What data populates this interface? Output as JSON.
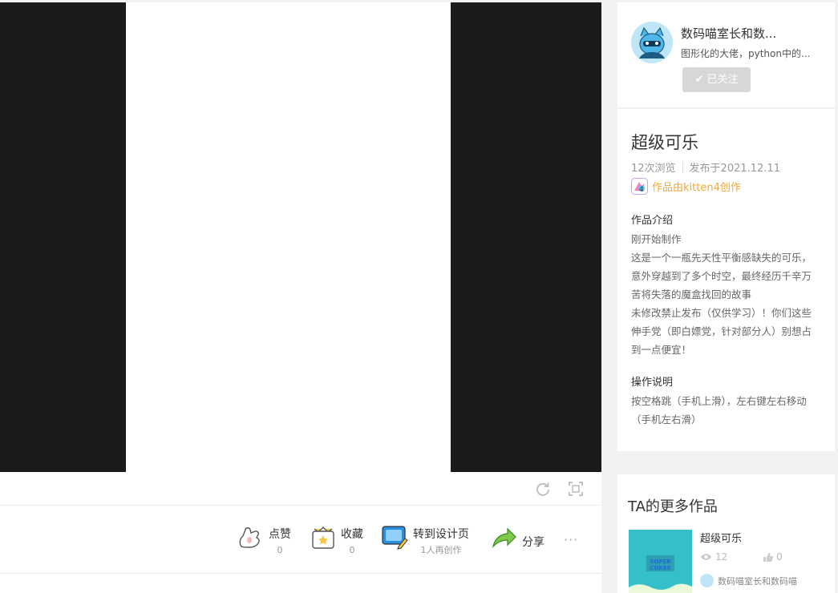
{
  "player": {
    "refresh_icon": "refresh-icon",
    "fullscreen_icon": "fullscreen-icon"
  },
  "actions": {
    "like": {
      "label": "点赞",
      "count": "0"
    },
    "collect": {
      "label": "收藏",
      "count": "0"
    },
    "remix": {
      "label": "转到设计页",
      "sub": "1人再创作"
    },
    "share": {
      "label": "分享"
    },
    "more_label": "···"
  },
  "author": {
    "name": "数码喵室长和数...",
    "desc": "图形化的大佬，python中的...",
    "follow_label": "✔ 已关注"
  },
  "work": {
    "title": "超级可乐",
    "views": "12次浏览",
    "published": "发布于2021.12.11",
    "creator": "作品由kitten4创作",
    "intro_heading": "作品介绍",
    "intro_lines": [
      "刚开始制作",
      "这是一个一瓶先天性平衡感缺失的可乐，",
      "意外穿越到了多个时空，最终经历千辛万",
      "苦将失落的魔盒找回的故事",
      "未修改禁止发布（仅供学习）！你们这些",
      "伸手党（即白嫖党，针对部分人）别想占",
      "到一点便宜！"
    ],
    "ops_heading": "操作说明",
    "ops_lines": [
      "按空格跳（手机上滑），左右键左右移动",
      "（手机左右滑）"
    ]
  },
  "more_works": {
    "heading": "TA的更多作品",
    "items": [
      {
        "title": "超级可乐",
        "views": "12",
        "likes": "0",
        "author": "数码喵室长和数码喵",
        "thumb_text": "SOPER COKES"
      }
    ]
  },
  "colors": {
    "stage_bg": "#1b1b1b",
    "accent_orange": "#f0a832",
    "follow_bg": "#d7d7d7"
  }
}
